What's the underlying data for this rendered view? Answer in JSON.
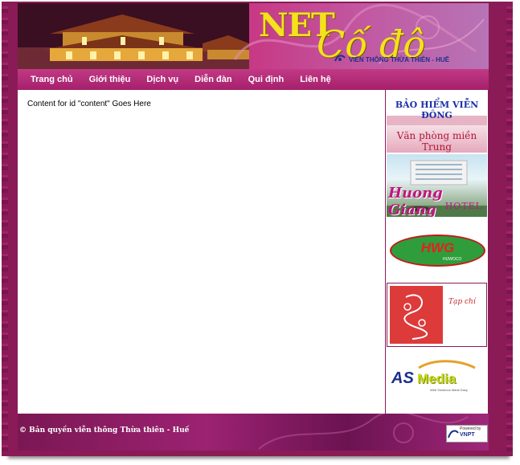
{
  "header": {
    "logo_top": "NET",
    "logo_bottom": "Cố đô",
    "tagline": "VIỄN THÔNG THỪA THIÊN - HUẾ"
  },
  "nav": {
    "items": [
      {
        "label": "Trang chủ"
      },
      {
        "label": "Giới thiệu"
      },
      {
        "label": "Dịch vụ"
      },
      {
        "label": "Diễn đàn"
      },
      {
        "label": "Qui định"
      },
      {
        "label": "Liên hệ"
      }
    ]
  },
  "content": {
    "text": "Content for id \"content\" Goes Here"
  },
  "sidebar": {
    "ad1": {
      "line1": "BẢO HIỂM VIỄN ĐÔNG",
      "line2": "Văn phòng miền Trung"
    },
    "ad2": {
      "name": "Huong Giang",
      "sub": "HOTEL"
    },
    "ad3": {
      "name": "HWG",
      "sub": "HUWOCO"
    },
    "ad4": {
      "text": "Tạp chí"
    },
    "ad5": {
      "part1": "AS",
      "part2": "Media",
      "tagline": "Web Solutions Made Easy"
    }
  },
  "footer": {
    "copyright": "© Bản quyền viễn thông Thừa thiên - Huế",
    "powered_label": "Powered by",
    "powered_brand": "VNPT"
  },
  "colors": {
    "brand": "#8a1b57",
    "nav": "#b02a76",
    "logo": "#f3e21c"
  }
}
